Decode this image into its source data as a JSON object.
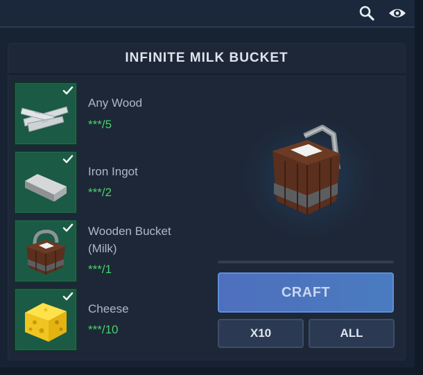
{
  "header": {
    "search_icon": "search-icon",
    "eye_icon": "eye-icon"
  },
  "panel": {
    "title": "INFINITE MILK BUCKET"
  },
  "ingredients": [
    {
      "name_line1": "Any Wood",
      "name_line2": "",
      "count": "***/5",
      "icon": "wood-planks-icon",
      "satisfied": true
    },
    {
      "name_line1": "Iron Ingot",
      "name_line2": "",
      "count": "***/2",
      "icon": "iron-ingot-icon",
      "satisfied": true
    },
    {
      "name_line1": "Wooden Bucket",
      "name_line2": "(Milk)",
      "count": "***/1",
      "icon": "wooden-bucket-milk-icon",
      "satisfied": true
    },
    {
      "name_line1": "Cheese",
      "name_line2": "",
      "count": "***/10",
      "icon": "cheese-icon",
      "satisfied": true
    }
  ],
  "result": {
    "icon": "infinite-milk-bucket-icon"
  },
  "craft_progress": 0,
  "buttons": {
    "craft": "CRAFT",
    "x10": "X10",
    "all": "ALL"
  },
  "colors": {
    "slot_green": "#1b5a45",
    "count_green": "#47d46a",
    "craft_blue": "#4e6fbd"
  }
}
